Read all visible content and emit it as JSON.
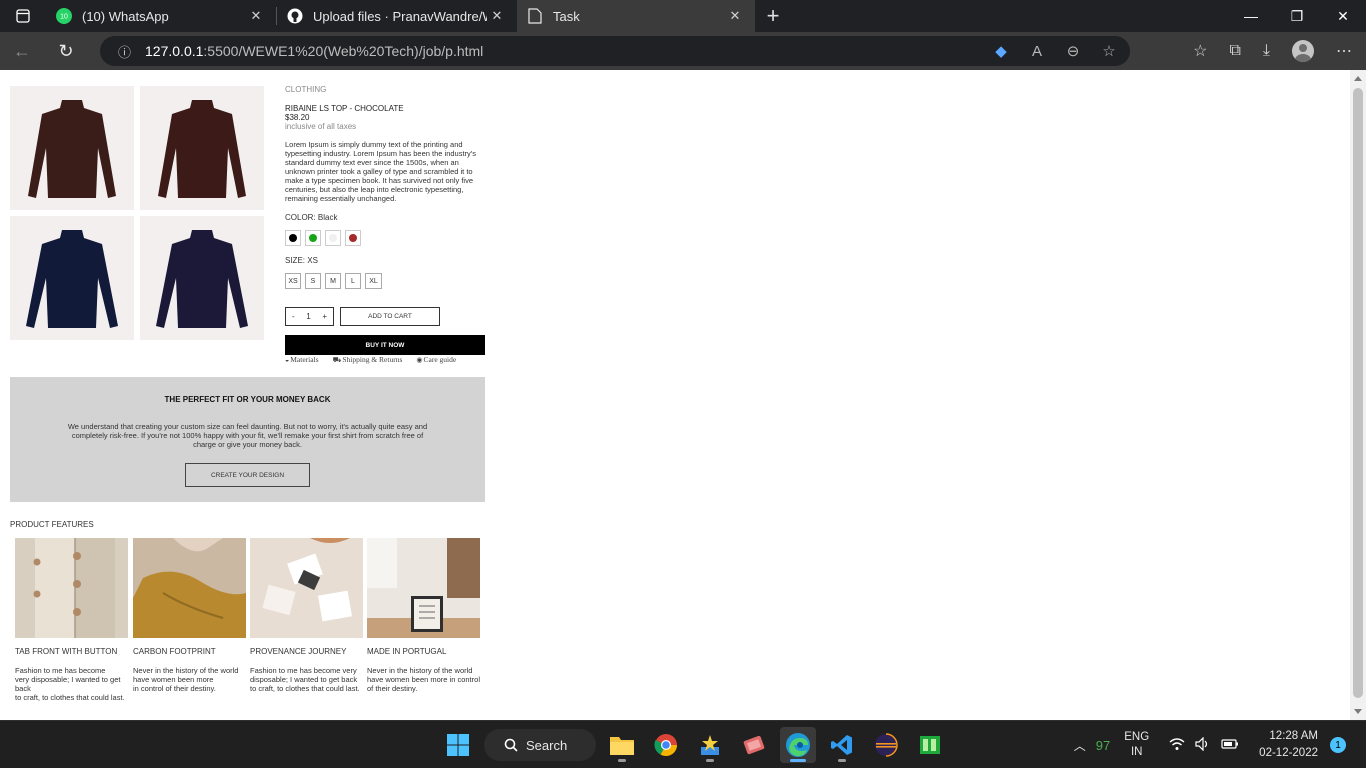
{
  "browser": {
    "tabs": [
      {
        "title": "(10) WhatsApp",
        "icon": "whatsapp-icon",
        "badge": "10"
      },
      {
        "title": "Upload files · PranavWandre/Web",
        "icon": "github-icon"
      },
      {
        "title": "Task",
        "icon": "document-icon"
      }
    ],
    "url_host": "127.0.0.1",
    "url_path": ":5500/WEWE1%20(Web%20Tech)/job/p.html"
  },
  "product": {
    "category": "CLOTHING",
    "name": "RIBAINE LS TOP - CHOCOLATE",
    "price": "$38.20",
    "taxes": "inclusive of all taxes",
    "description": "Lorem Ipsum is simply dummy text of the printing and typesetting industry. Lorem Ipsum has been the industry's standard dummy text ever since the 1500s, when an unknown printer took a galley of type and scrambled it to make a type specimen book. It has survived not only five centuries, but also the leap into electronic typesetting, remaining essentially unchanged.",
    "color_label": "COLOR: Black",
    "colors": [
      "#000000",
      "#18a418",
      "#f0f0f0",
      "#a52a2a"
    ],
    "size_label": "SIZE: XS",
    "sizes": [
      "XS",
      "S",
      "M",
      "L",
      "XL"
    ],
    "qty_minus": "-",
    "qty_value": "1",
    "qty_plus": "+",
    "add_to_cart": "ADD TO CART",
    "buy_now": "BUY IT NOW",
    "links": [
      {
        "label": "Materials",
        "icon": "materials-icon"
      },
      {
        "label": "Shipping & Returns",
        "icon": "truck-icon"
      },
      {
        "label": "Care guide",
        "icon": "eye-icon"
      }
    ]
  },
  "fit_banner": {
    "title": "THE PERFECT FIT OR YOUR MONEY BACK",
    "text": "We understand that creating your custom size can feel daunting. But not to worry, it's actually quite easy and completely risk-free. If you're not 100% happy with your fit, we'll remake your first shirt from scratch free of charge or give your money back.",
    "cta": "CREATE YOUR DESIGN"
  },
  "features": {
    "title": "PRODUCT FEATURES",
    "items": [
      {
        "name": "TAB FRONT WITH BUTTON",
        "text": "Fashion to me has become\nvery disposable; I wanted to get back\nto craft, to clothes that could last."
      },
      {
        "name": "CARBON FOOTPRINT",
        "text": "Never in the history of the world\nhave women been more\nin control of their destiny."
      },
      {
        "name": "PROVENANCE JOURNEY",
        "text": "Fashion to me has become very\ndisposable; I wanted to get back\nto craft, to clothes that could last."
      },
      {
        "name": "MADE IN PORTUGAL",
        "text": "Never in the history of the world\nhave women been more in control\nof their destiny."
      }
    ]
  },
  "taskbar": {
    "search_label": "Search",
    "cpu": "97",
    "lang_top": "ENG",
    "lang_bottom": "IN",
    "time": "12:28 AM",
    "date": "02-12-2022",
    "notifications": "1"
  }
}
